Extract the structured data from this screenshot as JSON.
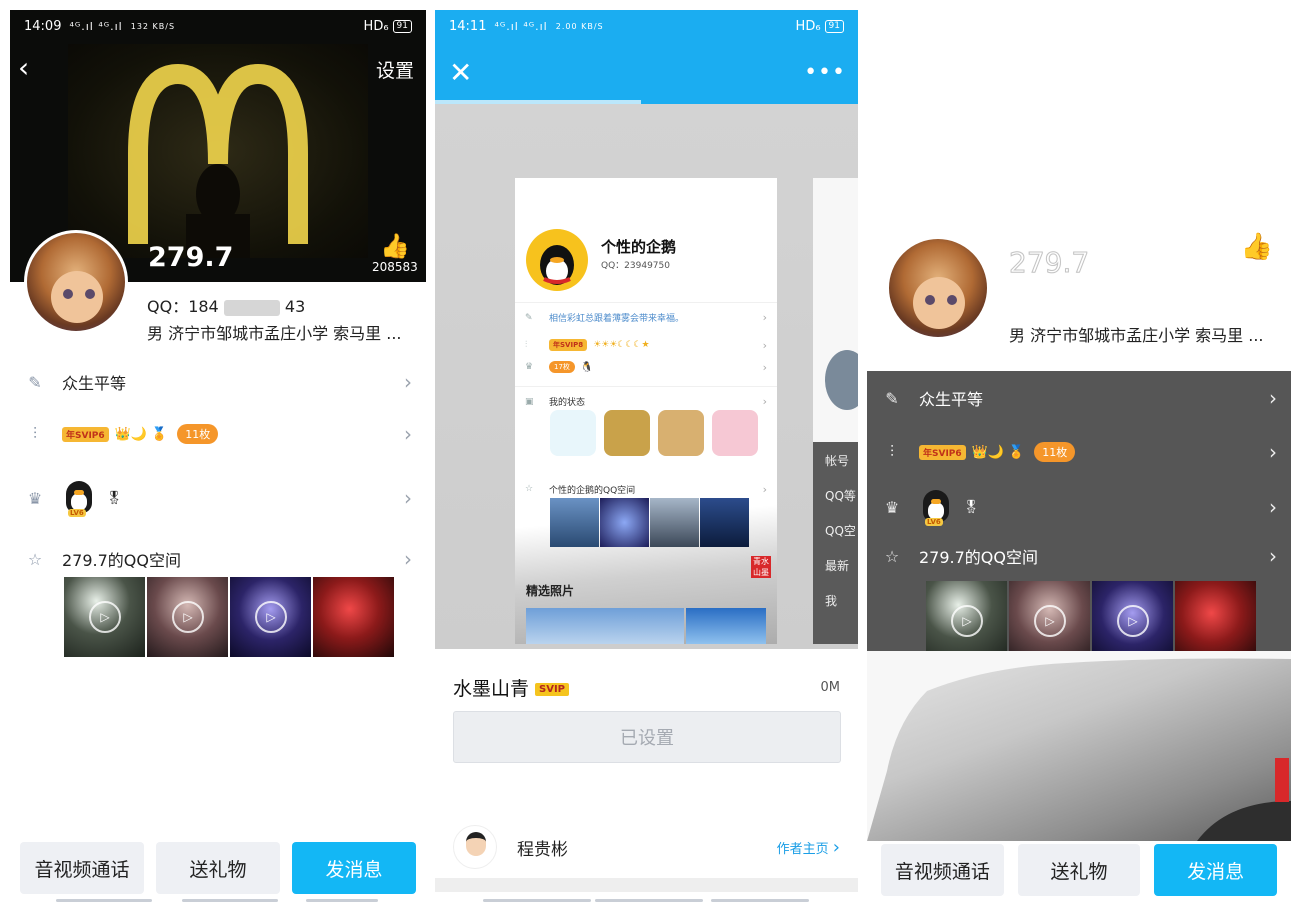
{
  "profile_left": {
    "status_bar": {
      "time": "14:09",
      "signal": "⁴ᴳ.ıl ⁴ᴳ.ıl",
      "speed": "132 KB/S",
      "hd": "HD₆",
      "battery": "91"
    },
    "settings_label": "设置",
    "nickname": "279.7",
    "like_count": "208583",
    "qq_prefix": "QQ：184",
    "qq_suffix": "43",
    "info": "男  济宁市邹城市孟庄小学  索马里 ...",
    "signature": "众生平等",
    "svip_label": "年SVIP6",
    "badge_count": "11枚",
    "penguin_level": "LV6",
    "space_title": "279.7的QQ空间",
    "buttons": {
      "call": "音视频通话",
      "gift": "送礼物",
      "message": "发消息"
    }
  },
  "theme_preview": {
    "status_bar": {
      "time": "14:11",
      "signal": "⁴ᴳ.ıl ⁴ᴳ.ıl",
      "speed": "2.00 KB/S",
      "hd": "HD₆",
      "battery": "91"
    },
    "more_label": "•••",
    "card": {
      "name": "个性的企鹅",
      "qq": "QQ：23949750",
      "signature": "相信彩虹总跟着薄雾会带来幸福。",
      "svip_label": "年SVIP8",
      "badge_count": "17枚",
      "status_label": "我的状态",
      "space_label": "个性的企鹅的QQ空间",
      "featured_label": "精选照片",
      "stamp": "青水 山墨"
    },
    "next_card_rows": [
      "帐号",
      "QQ等",
      "QQ空",
      "最新",
      "我"
    ],
    "theme_name": "水墨山青",
    "theme_badge": "SVIP",
    "theme_size": "0M",
    "set_button": "已设置",
    "author_name": "程贵彬",
    "author_link": "作者主页"
  },
  "profile_right": {
    "nickname": "279.7",
    "info": "男  济宁市邹城市孟庄小学  索马里 ...",
    "signature": "众生平等",
    "svip_label": "年SVIP6",
    "badge_count": "11枚",
    "penguin_level": "LV6",
    "space_title": "279.7的QQ空间",
    "buttons": {
      "call": "音视频通话",
      "gift": "送礼物",
      "message": "发消息"
    }
  },
  "icons": {
    "back": "chevron-left-icon",
    "close": "close-icon",
    "like": "thumbs-up-icon",
    "edit": "pencil-icon",
    "level": "bar-chart-icon",
    "crown": "crown-icon",
    "star": "star-icon",
    "chevron": "chevron-right-icon",
    "play": "play-icon"
  },
  "colors": {
    "accent": "#13b7f5",
    "header_blue": "#1badf1",
    "svip_gold": "#f6b733",
    "badge_orange": "#f5962a",
    "stamp_red": "#d8282a"
  }
}
